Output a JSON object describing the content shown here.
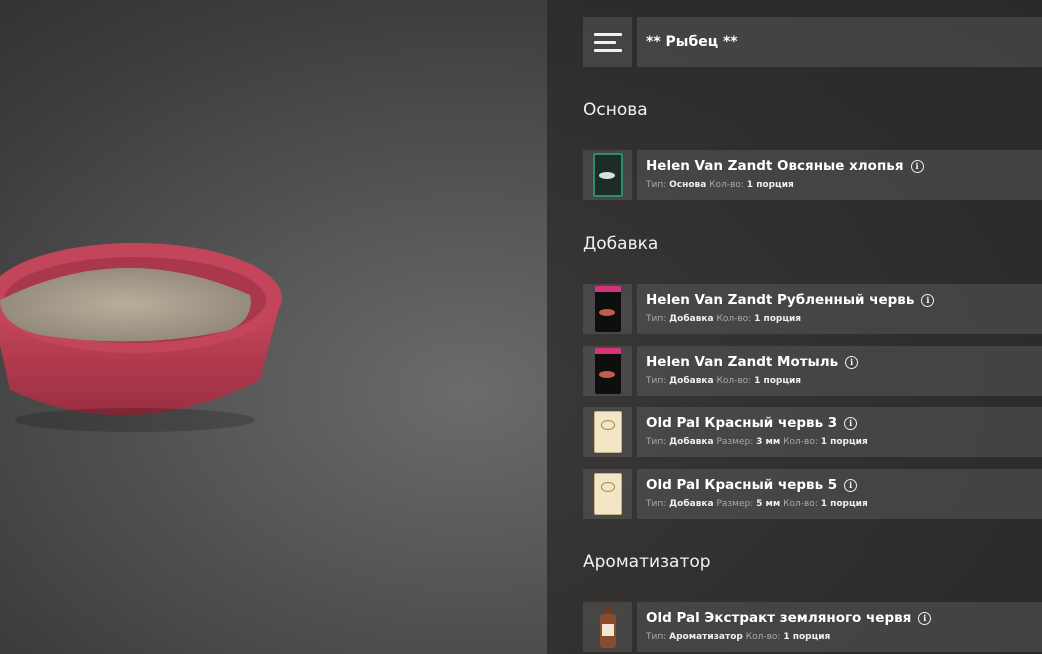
{
  "recipe_title": "** Рыбец **",
  "sections": {
    "base": "Основа",
    "additive": "Добавка",
    "flavor": "Ароматизатор"
  },
  "labels": {
    "type": "Тип:",
    "size": "Размер:",
    "qty": "Кол-во:"
  },
  "items": [
    {
      "name": "Helen Van Zandt Овсяные хлопья",
      "type": "Основа",
      "qty": "1 порция",
      "icon": "oat-flakes-pack-icon"
    },
    {
      "name": "Helen Van Zandt Рубленный червь",
      "type": "Добавка",
      "qty": "1 порция",
      "icon": "chopped-worm-pack-icon"
    },
    {
      "name": "Helen Van Zandt Мотыль",
      "type": "Добавка",
      "qty": "1 порция",
      "icon": "bloodworm-pack-icon"
    },
    {
      "name": "Old Pal Красный червь 3",
      "type": "Добавка",
      "size": "3 мм",
      "qty": "1 порция",
      "icon": "red-worm-pack-icon"
    },
    {
      "name": "Old Pal Красный червь 5",
      "type": "Добавка",
      "size": "5 мм",
      "qty": "1 порция",
      "icon": "red-worm-pack-icon"
    },
    {
      "name": "Old Pal Экстракт земляного червя",
      "type": "Ароматизатор",
      "qty": "1 порция",
      "icon": "earthworm-extract-bottle-icon"
    }
  ],
  "info_glyph": "i"
}
